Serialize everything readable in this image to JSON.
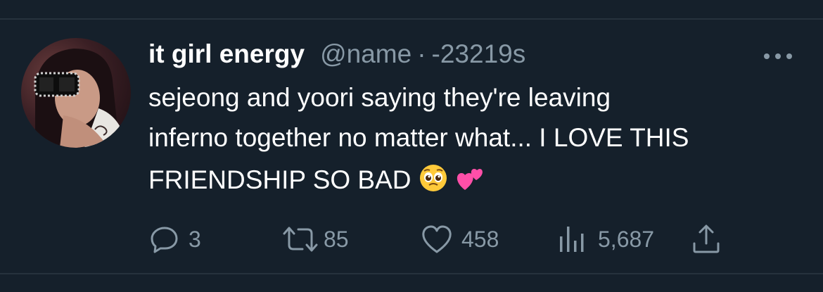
{
  "tweet": {
    "display_name": "it girl energy",
    "handle": "@name",
    "separator": "·",
    "timestamp": "-23219s",
    "text_lines": [
      "sejeong and yoori saying they're leaving",
      "inferno together no matter what... I LOVE THIS",
      "FRIENDSHIP SO BAD"
    ],
    "emojis": [
      "pleading-face",
      "two-hearts"
    ]
  },
  "actions": {
    "reply_count": "3",
    "retweet_count": "85",
    "like_count": "458",
    "views_count": "5,687"
  },
  "colors": {
    "background": "#15202b",
    "text": "#ffffff",
    "secondary": "#8899a6",
    "divider": "#26323d"
  }
}
